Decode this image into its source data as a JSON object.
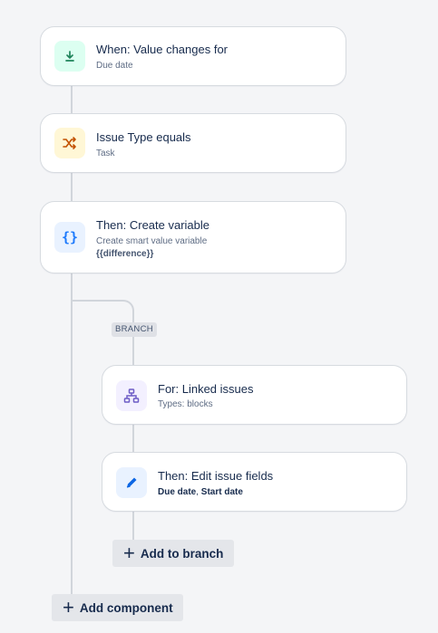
{
  "trigger": {
    "title": "When: Value changes for",
    "subtitle": "Due date",
    "icon": "download-icon",
    "icon_color": "#1f845a",
    "icon_bg": "#dcfff1"
  },
  "condition": {
    "title": "Issue Type equals",
    "subtitle": "Task",
    "icon": "shuffle-icon",
    "icon_color": "#c25100",
    "icon_bg": "#fff7d6"
  },
  "action_variable": {
    "title": "Then: Create variable",
    "subtitle": "Create smart value variable",
    "detail": "{{difference}}",
    "icon": "curly-braces-icon",
    "icon_color": "#1d7afc",
    "icon_bg": "#e9f2ff"
  },
  "branch": {
    "label": "BRANCH",
    "for_card": {
      "title": "For: Linked issues",
      "subtitle": "Types: blocks",
      "icon": "hierarchy-icon",
      "icon_color": "#6e5dc6",
      "icon_bg": "#f3f0ff"
    },
    "edit_card": {
      "title": "Then: Edit issue fields",
      "detail_bold": "Due date",
      "detail_sep": ",",
      "detail_rest": "Start date",
      "icon": "pencil-icon",
      "icon_color": "#0c66e4",
      "icon_bg": "#e9f2ff"
    },
    "add_button": "Add to branch"
  },
  "add_component_button": "Add component"
}
